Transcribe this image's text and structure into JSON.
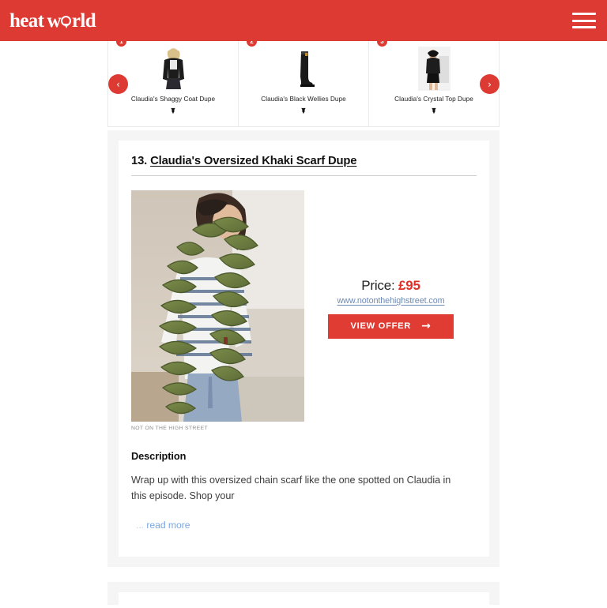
{
  "header": {
    "logo_text_1": "heat",
    "logo_text_2": "w",
    "logo_text_3": "rld",
    "menu_label": "Menu",
    "brand_color": "#dd3a33"
  },
  "carousel": {
    "prev_label": "‹",
    "next_label": "›",
    "chevron_glyph": "❯",
    "items": [
      {
        "badge": "1",
        "label": "Claudia's Shaggy Coat Dupe",
        "icon": "shaggy-coat-thumbnail"
      },
      {
        "badge": "2",
        "label": "Claudia's Black Wellies Dupe",
        "icon": "black-wellies-thumbnail"
      },
      {
        "badge": "3",
        "label": "Claudia's Crystal Top Dupe",
        "icon": "crystal-top-thumbnail"
      }
    ]
  },
  "product": {
    "number": "13.",
    "title": "Claudia's Oversized Khaki Scarf Dupe",
    "image_alt": "Woman wearing oversized chunky khaki green chain-knit scarf over a blue and white striped top",
    "image_credit": "NOT ON THE HIGH STREET",
    "price_label": "Price:",
    "price_value": "£95",
    "shop_url": "www.notonthehighstreet.com",
    "offer_button": "VIEW OFFER",
    "offer_arrow": "→",
    "description_heading": "Description",
    "description_text": "Wrap up with this oversized chain scarf like the one spotted on Claudia in this episode. Shop your",
    "read_more_dots": "...",
    "read_more_label": "read more"
  }
}
